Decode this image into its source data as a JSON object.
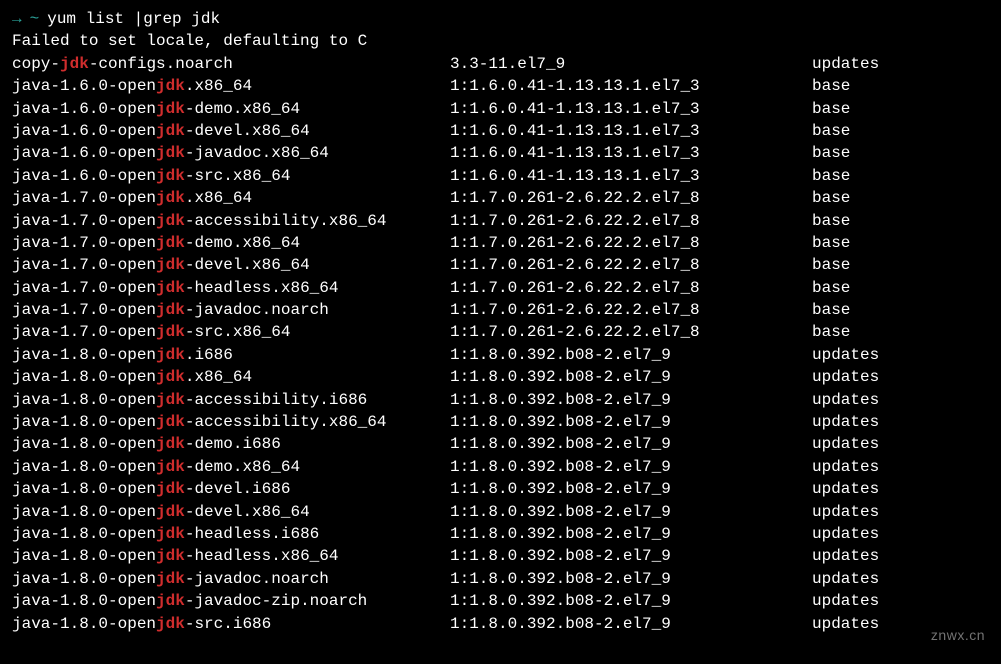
{
  "prompt": {
    "arrow": "→",
    "tilde": "~",
    "command": "yum list |grep jdk"
  },
  "error": "Failed to set locale, defaulting to C",
  "highlight": "jdk",
  "rows": [
    {
      "prefix": "copy-",
      "suffix": "-configs.noarch",
      "version": "3.3-11.el7_9",
      "repo": "updates"
    },
    {
      "prefix": "java-1.6.0-open",
      "suffix": ".x86_64",
      "version": "1:1.6.0.41-1.13.13.1.el7_3",
      "repo": "base"
    },
    {
      "prefix": "java-1.6.0-open",
      "suffix": "-demo.x86_64",
      "version": "1:1.6.0.41-1.13.13.1.el7_3",
      "repo": "base"
    },
    {
      "prefix": "java-1.6.0-open",
      "suffix": "-devel.x86_64",
      "version": "1:1.6.0.41-1.13.13.1.el7_3",
      "repo": "base"
    },
    {
      "prefix": "java-1.6.0-open",
      "suffix": "-javadoc.x86_64",
      "version": "1:1.6.0.41-1.13.13.1.el7_3",
      "repo": "base"
    },
    {
      "prefix": "java-1.6.0-open",
      "suffix": "-src.x86_64",
      "version": "1:1.6.0.41-1.13.13.1.el7_3",
      "repo": "base"
    },
    {
      "prefix": "java-1.7.0-open",
      "suffix": ".x86_64",
      "version": "1:1.7.0.261-2.6.22.2.el7_8",
      "repo": "base"
    },
    {
      "prefix": "java-1.7.0-open",
      "suffix": "-accessibility.x86_64",
      "version": "1:1.7.0.261-2.6.22.2.el7_8",
      "repo": "base"
    },
    {
      "prefix": "java-1.7.0-open",
      "suffix": "-demo.x86_64",
      "version": "1:1.7.0.261-2.6.22.2.el7_8",
      "repo": "base"
    },
    {
      "prefix": "java-1.7.0-open",
      "suffix": "-devel.x86_64",
      "version": "1:1.7.0.261-2.6.22.2.el7_8",
      "repo": "base"
    },
    {
      "prefix": "java-1.7.0-open",
      "suffix": "-headless.x86_64",
      "version": "1:1.7.0.261-2.6.22.2.el7_8",
      "repo": "base"
    },
    {
      "prefix": "java-1.7.0-open",
      "suffix": "-javadoc.noarch",
      "version": "1:1.7.0.261-2.6.22.2.el7_8",
      "repo": "base"
    },
    {
      "prefix": "java-1.7.0-open",
      "suffix": "-src.x86_64",
      "version": "1:1.7.0.261-2.6.22.2.el7_8",
      "repo": "base"
    },
    {
      "prefix": "java-1.8.0-open",
      "suffix": ".i686",
      "version": "1:1.8.0.392.b08-2.el7_9",
      "repo": "updates"
    },
    {
      "prefix": "java-1.8.0-open",
      "suffix": ".x86_64",
      "version": "1:1.8.0.392.b08-2.el7_9",
      "repo": "updates"
    },
    {
      "prefix": "java-1.8.0-open",
      "suffix": "-accessibility.i686",
      "version": "1:1.8.0.392.b08-2.el7_9",
      "repo": "updates"
    },
    {
      "prefix": "java-1.8.0-open",
      "suffix": "-accessibility.x86_64",
      "version": "1:1.8.0.392.b08-2.el7_9",
      "repo": "updates"
    },
    {
      "prefix": "java-1.8.0-open",
      "suffix": "-demo.i686",
      "version": "1:1.8.0.392.b08-2.el7_9",
      "repo": "updates"
    },
    {
      "prefix": "java-1.8.0-open",
      "suffix": "-demo.x86_64",
      "version": "1:1.8.0.392.b08-2.el7_9",
      "repo": "updates"
    },
    {
      "prefix": "java-1.8.0-open",
      "suffix": "-devel.i686",
      "version": "1:1.8.0.392.b08-2.el7_9",
      "repo": "updates"
    },
    {
      "prefix": "java-1.8.0-open",
      "suffix": "-devel.x86_64",
      "version": "1:1.8.0.392.b08-2.el7_9",
      "repo": "updates"
    },
    {
      "prefix": "java-1.8.0-open",
      "suffix": "-headless.i686",
      "version": "1:1.8.0.392.b08-2.el7_9",
      "repo": "updates"
    },
    {
      "prefix": "java-1.8.0-open",
      "suffix": "-headless.x86_64",
      "version": "1:1.8.0.392.b08-2.el7_9",
      "repo": "updates"
    },
    {
      "prefix": "java-1.8.0-open",
      "suffix": "-javadoc.noarch",
      "version": "1:1.8.0.392.b08-2.el7_9",
      "repo": "updates"
    },
    {
      "prefix": "java-1.8.0-open",
      "suffix": "-javadoc-zip.noarch",
      "version": "1:1.8.0.392.b08-2.el7_9",
      "repo": "updates"
    },
    {
      "prefix": "java-1.8.0-open",
      "suffix": "-src.i686",
      "version": "1:1.8.0.392.b08-2.el7_9",
      "repo": "updates"
    }
  ],
  "watermark": "znwx.cn"
}
